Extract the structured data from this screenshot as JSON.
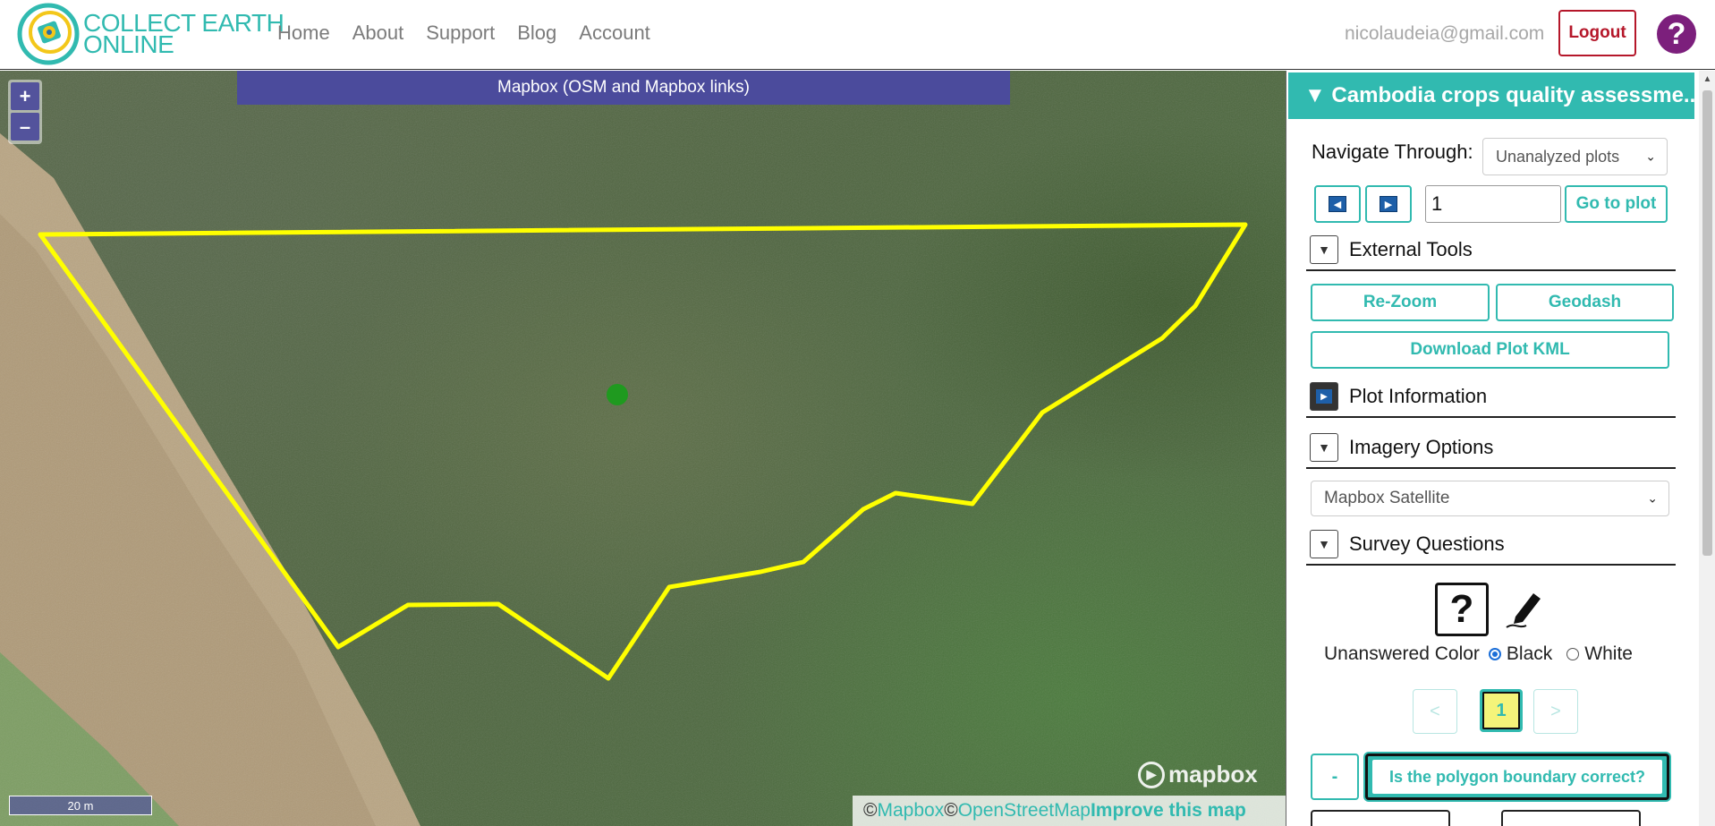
{
  "header": {
    "logo_line1": "COLLECT EARTH",
    "logo_line2": "ONLINE",
    "nav": [
      "Home",
      "About",
      "Support",
      "Blog",
      "Account"
    ],
    "user_email": "nicolaudeia@gmail.com",
    "logout_label": "Logout",
    "help_label": "?"
  },
  "map": {
    "imagery_banner": "Mapbox (OSM and Mapbox links)",
    "zoom_in": "+",
    "zoom_out": "–",
    "scale_label": "20 m",
    "logo_text": "mapbox",
    "attribution": {
      "copy1": "© ",
      "mapbox_link": "Mapbox",
      "copy2": "© ",
      "osm_link": "OpenStreetMap",
      "improve_link": "Improve this map"
    }
  },
  "sidebar": {
    "project_title": "▼ Cambodia crops quality assessme...",
    "navigate_label": "Navigate Through:",
    "navigate_value": "Unanalyzed plots",
    "plot_number": "1",
    "goto_label": "Go to plot",
    "external_tools": "External Tools",
    "rezoom_label": "Re-Zoom",
    "geodash_label": "Geodash",
    "download_kml_label": "Download Plot KML",
    "plot_information": "Plot Information",
    "imagery_options": "Imagery Options",
    "imagery_value": "Mapbox Satellite",
    "survey_questions": "Survey Questions",
    "unanswered_color_label": "Unanswered Color",
    "color_black": "Black",
    "color_white": "White",
    "page_prev": "<",
    "page_current": "1",
    "page_next": ">",
    "minus_label": "-",
    "question_label": "Is the polygon boundary correct?"
  },
  "colors": {
    "accent": "#31bab0",
    "logout": "#b5172a",
    "help": "#7c1f7c",
    "banner": "#4b4b9c",
    "polygon": "#ffff00",
    "sample_point": "#1f9a1f"
  }
}
